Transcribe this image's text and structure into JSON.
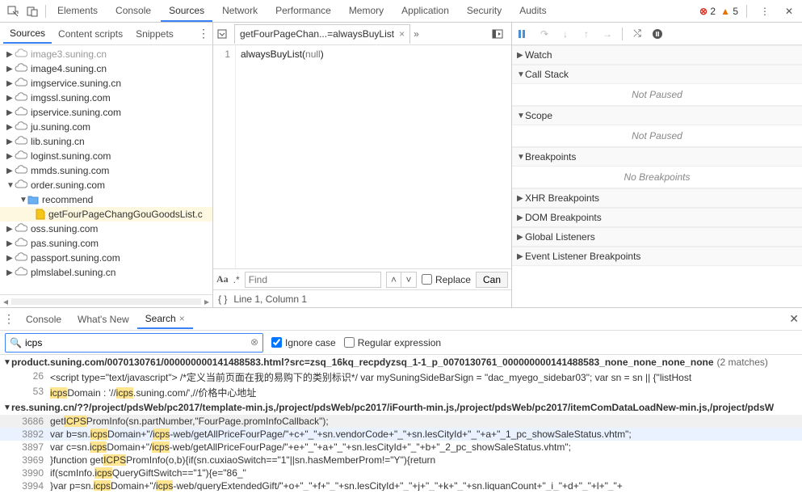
{
  "top_tabs": [
    "Elements",
    "Console",
    "Sources",
    "Network",
    "Performance",
    "Memory",
    "Application",
    "Security",
    "Audits"
  ],
  "active_top_tab": "Sources",
  "errors_count": "2",
  "warnings_count": "5",
  "left_tabs": [
    "Sources",
    "Content scripts",
    "Snippets"
  ],
  "active_left_tab": "Sources",
  "tree": {
    "truncated_top": "image4.suning.cn",
    "items": [
      "image4.suning.cn",
      "imgservice.suning.cn",
      "imgssl.suning.com",
      "ipservice.suning.com",
      "ju.suning.com",
      "lib.suning.cn",
      "loginst.suning.com",
      "mmds.suning.com"
    ],
    "expanded": "order.suning.com",
    "folder": "recommend",
    "file": "getFourPageChangGouGoodsList.c",
    "items_after": [
      "oss.suning.com",
      "pas.suning.com",
      "passport.suning.com",
      "plmslabel.suning.cn"
    ]
  },
  "source_tab": {
    "label": "getFourPageChan...=alwaysBuyList"
  },
  "editor": {
    "line1_num": "1",
    "line1_code_fn": "alwaysBuyList",
    "line1_code_arg": "null"
  },
  "find": {
    "placeholder": "Find",
    "replace_label": "Replace",
    "cancel_label": "Can"
  },
  "status": {
    "pos": "Line 1, Column 1"
  },
  "debug_sections": {
    "watch": "Watch",
    "callstack": "Call Stack",
    "callstack_msg": "Not Paused",
    "scope": "Scope",
    "scope_msg": "Not Paused",
    "breakpoints": "Breakpoints",
    "breakpoints_msg": "No Breakpoints",
    "xhr": "XHR Breakpoints",
    "dom": "DOM Breakpoints",
    "globals": "Global Listeners",
    "evt": "Event Listener Breakpoints"
  },
  "drawer_tabs": {
    "console": "Console",
    "whatsnew": "What's New",
    "search": "Search"
  },
  "search": {
    "query": "icps",
    "ignore_case": "Ignore case",
    "regex": "Regular expression"
  },
  "results": {
    "file1": {
      "name": "product.suning.com/0070130761/000000000141488583.html?src=zsq_16kq_recpdyzsq_1-1_p_0070130761_000000000141488583_none_none_none_none",
      "matches": "(2 matches)"
    },
    "l26": {
      "ln": "26",
      "pre": "<script type=\"text/javascript\"> /*定义当前页面在我的易购下的类别标识*/ var mySuningSideBarSign = \"dac_myego_sidebar03\"; var sn = sn || {\"listHost"
    },
    "l53": {
      "ln": "53",
      "pre": "icps",
      "mid": "Domain : '//",
      "h2": "icps",
      "suf": ".suning.com/',//价格中心地址"
    },
    "file2": {
      "name": "res.suning.cn/??/project/pdsWeb/pc2017/template-min.js,/project/pdsWeb/pc2017/iFourth-min.js,/project/pdsWeb/pc2017/itemComDataLoadNew-min.js,/project/pdsW"
    },
    "l3686": {
      "ln": "3686",
      "t": "getICPSPromInfo(sn.partNumber,\"FourPage.promInfoCallback\");"
    },
    "l3892": {
      "ln": "3892",
      "t": "var b=sn.icpsDomain+\"/icps-web/getAllPriceFourPage/\"+c+\"_\"+sn.vendorCode+\"_\"+sn.lesCityId+\"_\"+a+\"_1_pc_showSaleStatus.vhtm\";"
    },
    "l3897": {
      "ln": "3897",
      "t": "var c=sn.icpsDomain+\"/icps-web/getAllPriceFourPage/\"+e+\"_\"+a+\"_\"+sn.lesCityId+\"_\"+b+\"_2_pc_showSaleStatus.vhtm\";"
    },
    "l3969": {
      "ln": "3969",
      "t": "}function getICPSPromInfo(o,b){if(sn.cuxiaoSwitch==\"1\"||sn.hasMemberProm!=\"Y\"){return"
    },
    "l3990": {
      "ln": "3990",
      "t": "if(scmInfo.icpsQueryGiftSwitch==\"1\"){e=\"86_\""
    },
    "l3994": {
      "ln": "3994",
      "t": "}var p=sn.icpsDomain+\"/icps-web/queryExtendedGift/\"+o+\"_\"+f+\"_\"+sn.lesCityId+\"_\"+j+\"_\"+k+\"_\"+sn.liquanCount+\"_i_\"+d+\"_\"+l+\"_\"+"
    }
  }
}
